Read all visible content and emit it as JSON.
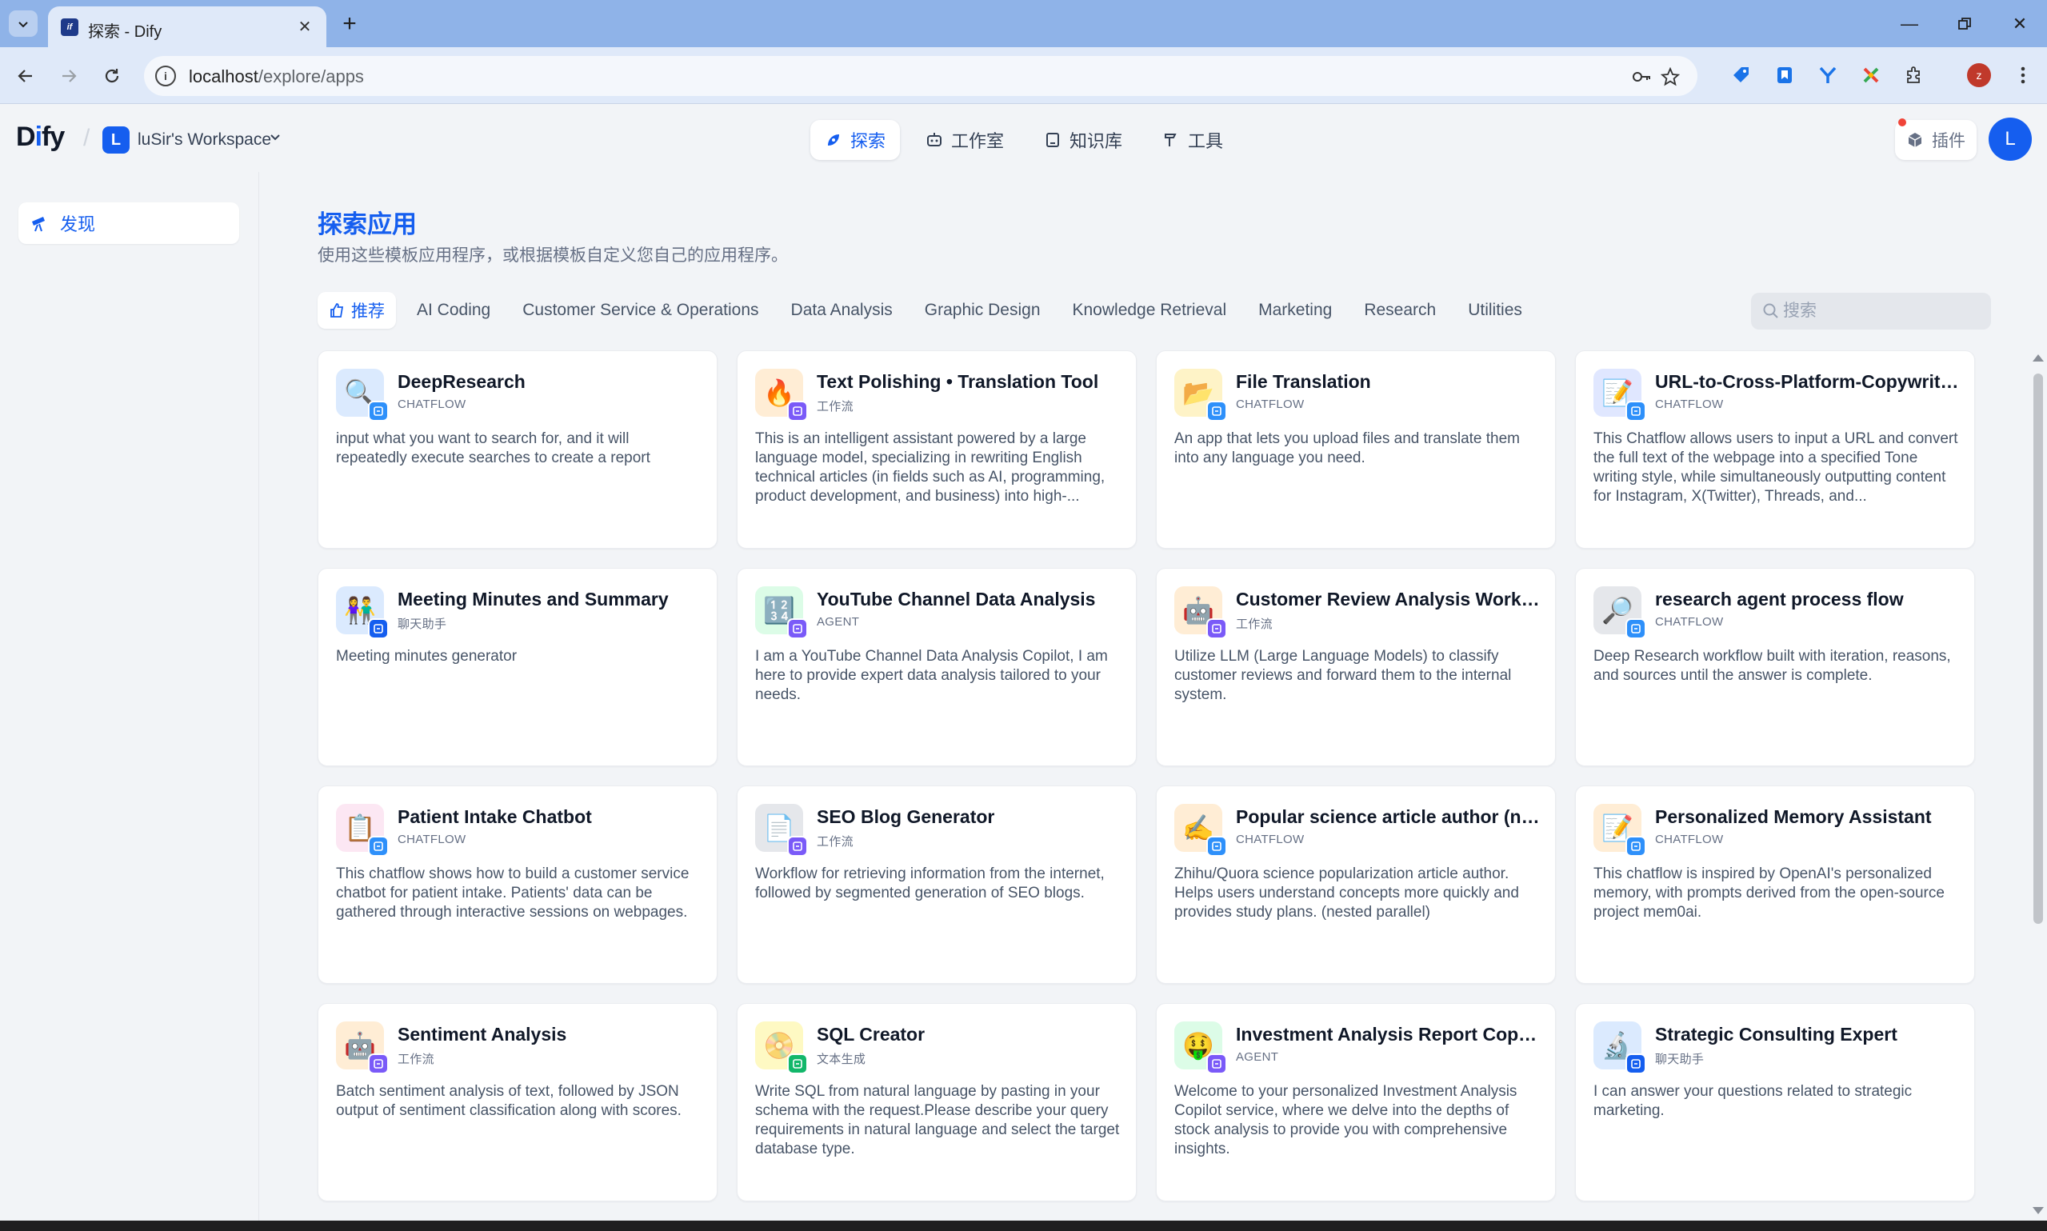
{
  "browser": {
    "tab_title": "探索 - Dify",
    "url_host": "localhost",
    "url_path": "/explore/apps",
    "profile_letter": "z"
  },
  "header": {
    "logo_text": "Dify",
    "workspace_initial": "L",
    "workspace_name": "luSir's Workspace",
    "nav": [
      {
        "label": "探索",
        "icon": "compass-icon",
        "active": true
      },
      {
        "label": "工作室",
        "icon": "robot-icon",
        "active": false
      },
      {
        "label": "知识库",
        "icon": "book-icon",
        "active": false
      },
      {
        "label": "工具",
        "icon": "hammer-icon",
        "active": false
      }
    ],
    "plugins_label": "插件",
    "user_initial": "L"
  },
  "sidebar": {
    "items": [
      {
        "label": "发现",
        "icon": "telescope-icon"
      }
    ]
  },
  "main": {
    "title": "探索应用",
    "subtitle": "使用这些模板应用程序，或根据模板自定义您自己的应用程序。",
    "categories": [
      {
        "label": "推荐",
        "active": true
      },
      {
        "label": "AI Coding"
      },
      {
        "label": "Customer Service & Operations"
      },
      {
        "label": "Data Analysis"
      },
      {
        "label": "Graphic Design"
      },
      {
        "label": "Knowledge Retrieval"
      },
      {
        "label": "Marketing"
      },
      {
        "label": "Research"
      },
      {
        "label": "Utilities"
      }
    ],
    "search_placeholder": "搜索",
    "apps": [
      {
        "title": "DeepResearch",
        "type": "CHATFLOW",
        "desc": "input what you want to search for, and it will repeatedly execute searches to create a report",
        "icon": "🔍",
        "bg": "#dbeafe",
        "badge": "#2e90fa"
      },
      {
        "title": "Text Polishing • Translation Tool",
        "type": "工作流",
        "desc": "This is an intelligent assistant powered by a large language model, specializing in rewriting English technical articles (in fields such as AI, programming, product development, and business) into high-...",
        "icon": "🔥",
        "bg": "#ffedd5",
        "badge": "#7a5af8"
      },
      {
        "title": "File Translation",
        "type": "CHATFLOW",
        "desc": "An app that lets you upload files and translate them into any language you need.",
        "icon": "📂",
        "bg": "#fef3c7",
        "badge": "#2e90fa"
      },
      {
        "title": "URL-to-Cross-Platform-Copywriting",
        "type": "CHATFLOW",
        "desc": "This Chatflow allows users to input a URL and convert the full text of the webpage into a specified Tone writing style, while simultaneously outputting content for Instagram, X(Twitter), Threads, and...",
        "icon": "📝",
        "bg": "#e0e7ff",
        "badge": "#2e90fa"
      },
      {
        "title": "Meeting Minutes and Summary",
        "type": "聊天助手",
        "desc": "Meeting minutes generator",
        "icon": "👫",
        "bg": "#dbeafe",
        "badge": "#155eef"
      },
      {
        "title": "YouTube Channel Data Analysis",
        "type": "AGENT",
        "desc": "I am a YouTube Channel Data Analysis Copilot, I am here to provide expert data analysis tailored to your needs.",
        "icon": "🔢",
        "bg": "#dcfce7",
        "badge": "#7a5af8"
      },
      {
        "title": "Customer Review Analysis Workflow",
        "type": "工作流",
        "desc": "Utilize LLM (Large Language Models) to classify customer reviews and forward them to the internal system.",
        "icon": "🤖",
        "bg": "#ffedd5",
        "badge": "#7a5af8"
      },
      {
        "title": "research agent process flow",
        "type": "CHATFLOW",
        "desc": "Deep Research workflow built with iteration, reasons, and sources until the answer is complete.",
        "icon": "🔎",
        "bg": "#e5e7eb",
        "badge": "#2e90fa"
      },
      {
        "title": "Patient Intake Chatbot",
        "type": "CHATFLOW",
        "desc": "This chatflow shows how to build a customer service chatbot for patient intake. Patients' data can be gathered through interactive sessions on webpages.",
        "icon": "📋",
        "bg": "#fce7f3",
        "badge": "#2e90fa"
      },
      {
        "title": "SEO Blog Generator",
        "type": "工作流",
        "desc": "Workflow for retrieving information from the internet, followed by segmented generation of SEO blogs.",
        "icon": "📄",
        "bg": "#e5e7eb",
        "badge": "#7a5af8"
      },
      {
        "title": "Popular science article author (nested parallel)",
        "type": "CHATFLOW",
        "desc": "Zhihu/Quora science popularization article author. Helps users understand concepts more quickly and provides study plans. (nested parallel)",
        "icon": "✍️",
        "bg": "#ffedd5",
        "badge": "#2e90fa"
      },
      {
        "title": "Personalized Memory Assistant",
        "type": "CHATFLOW",
        "desc": "This chatflow is inspired by OpenAI's personalized memory, with prompts derived from the open-source project mem0ai.",
        "icon": "📝",
        "bg": "#ffedd5",
        "badge": "#2e90fa"
      },
      {
        "title": "Sentiment Analysis",
        "type": "工作流",
        "desc": "Batch sentiment analysis of text, followed by JSON output of sentiment classification along with scores.",
        "icon": "🤖",
        "bg": "#ffedd5",
        "badge": "#7a5af8"
      },
      {
        "title": "SQL Creator",
        "type": "文本生成",
        "desc": "Write SQL from natural language by pasting in your schema with the request.Please describe your query requirements in natural language and select the target database type.",
        "icon": "📀",
        "bg": "#fef9c3",
        "badge": "#12b76a"
      },
      {
        "title": "Investment Analysis Report Copilot",
        "type": "AGENT",
        "desc": "Welcome to your personalized Investment Analysis Copilot service, where we delve into the depths of stock analysis to provide you with comprehensive insights.",
        "icon": "🤑",
        "bg": "#dcfce7",
        "badge": "#7a5af8"
      },
      {
        "title": "Strategic Consulting Expert",
        "type": "聊天助手",
        "desc": "I can answer your questions related to strategic marketing.",
        "icon": "🔬",
        "bg": "#dbeafe",
        "badge": "#155eef"
      }
    ]
  },
  "colors": {
    "accent": "#155eef",
    "page_bg": "#f2f4f7"
  }
}
